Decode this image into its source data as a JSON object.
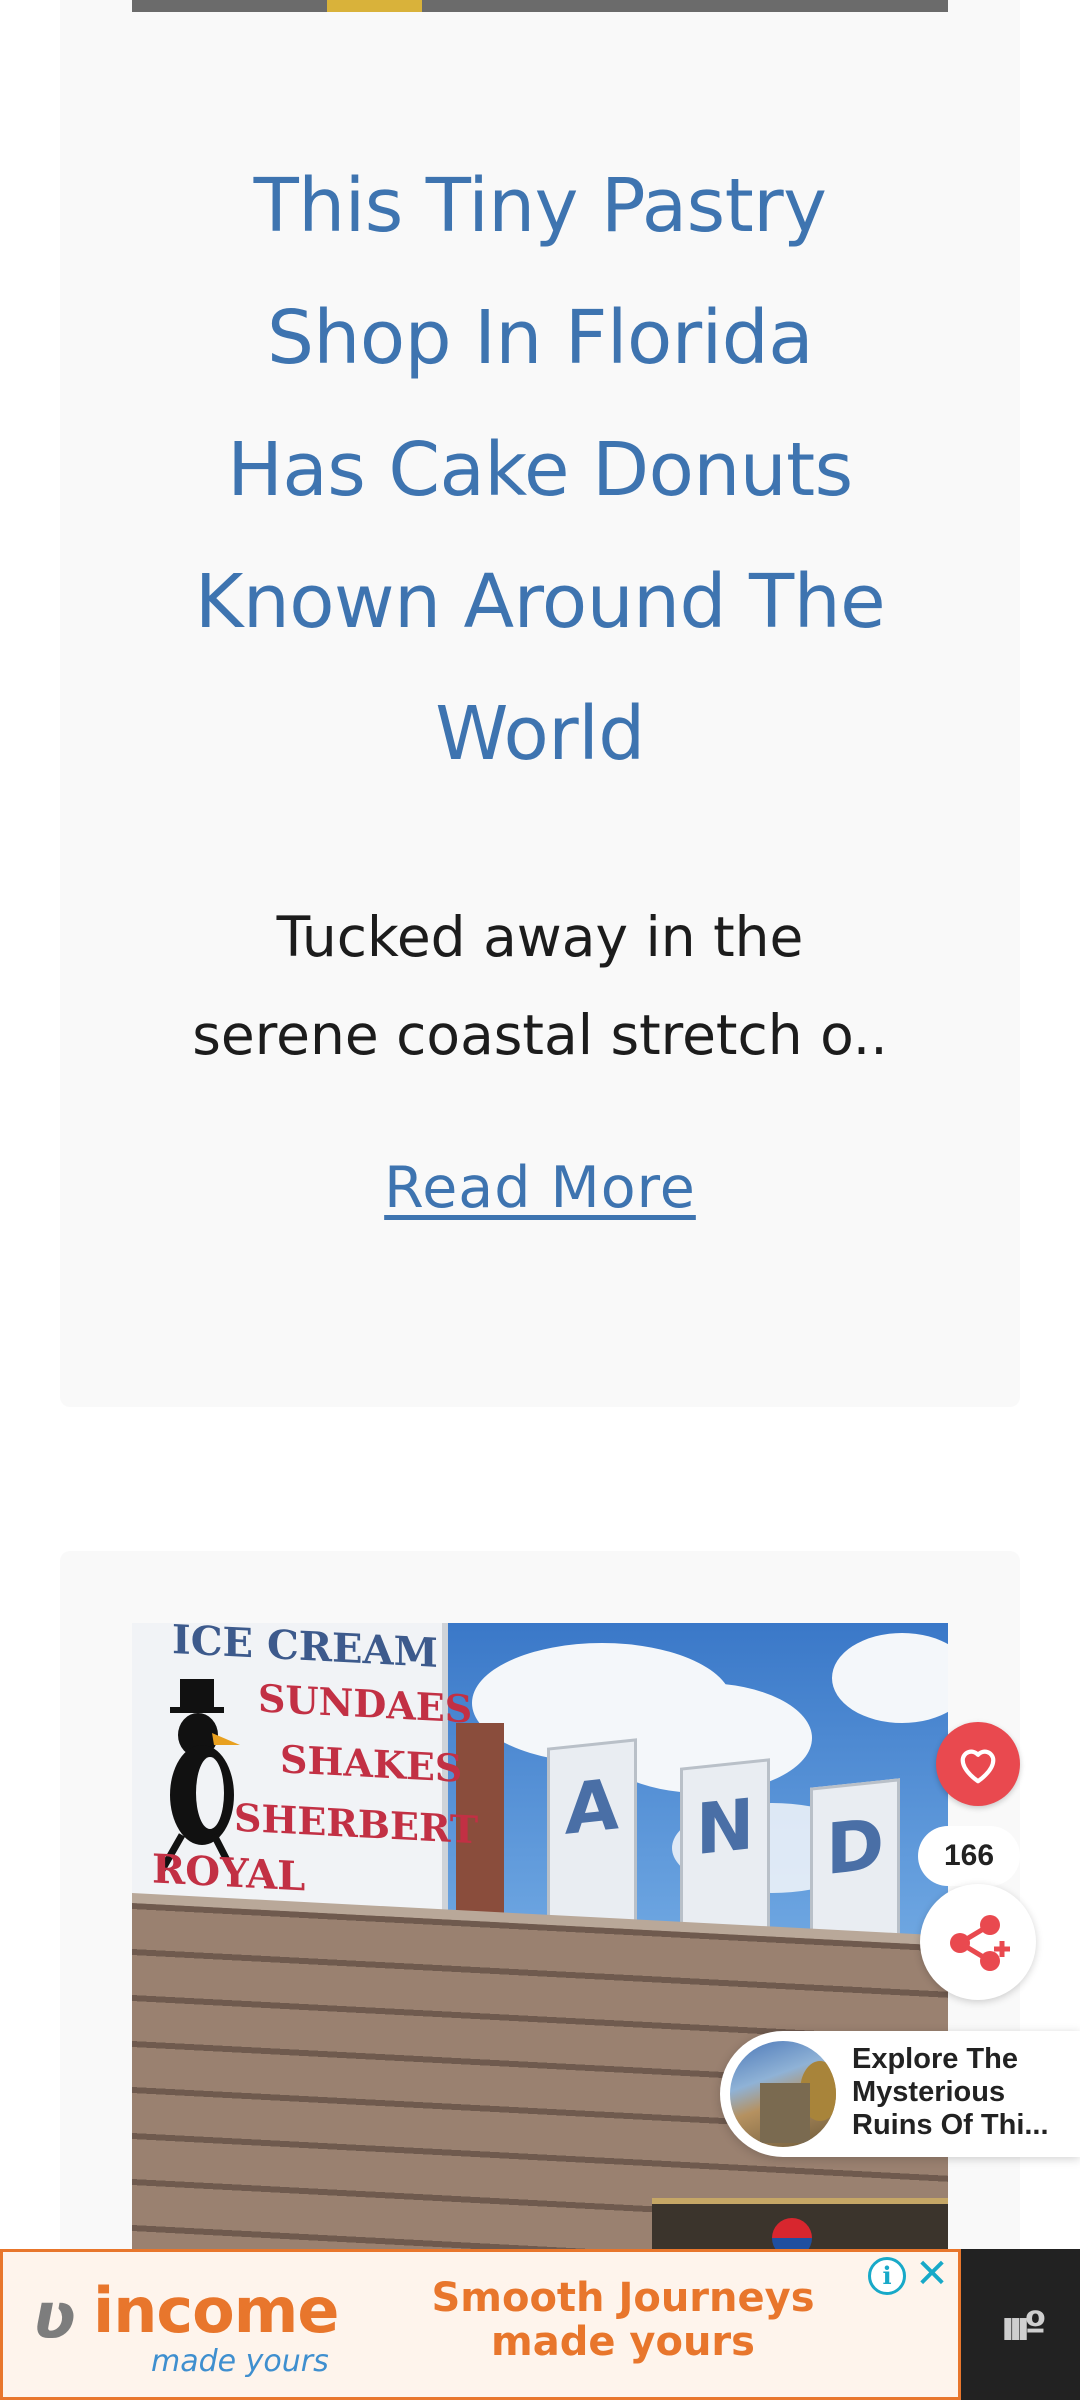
{
  "card1": {
    "title_lines": [
      "This Tiny Pastry",
      "Shop In Florida",
      "Has Cake Donuts",
      "Known Around The",
      "World"
    ],
    "excerpt_lines": [
      "Tucked away in the",
      "serene coastal stretch o.."
    ],
    "read_more": "Read More"
  },
  "card2": {
    "image": {
      "sign_lines": [
        "ICE CREAM",
        "SUNDAES",
        "SHAKES",
        "SHERBERT",
        "ROYAL TREATS"
      ],
      "letters": [
        "A",
        "N",
        "D"
      ]
    }
  },
  "actions": {
    "like_count": "166",
    "like_icon": "heart-icon",
    "share_icon": "share-icon"
  },
  "related": {
    "title_lines": [
      "Explore The",
      "Mysterious",
      "Ruins Of Thi..."
    ]
  },
  "ad": {
    "brand": "income",
    "brand_tag": "made yours",
    "headline_lines": [
      "Smooth Journeys",
      "made yours"
    ],
    "info_icon": "i",
    "close_icon": "✕",
    "side_logo": "ıııº"
  },
  "colors": {
    "link": "#3e74b0",
    "accent_red": "#e9494f",
    "ad_orange": "#e8762c",
    "ad_blue": "#18a9c8"
  }
}
